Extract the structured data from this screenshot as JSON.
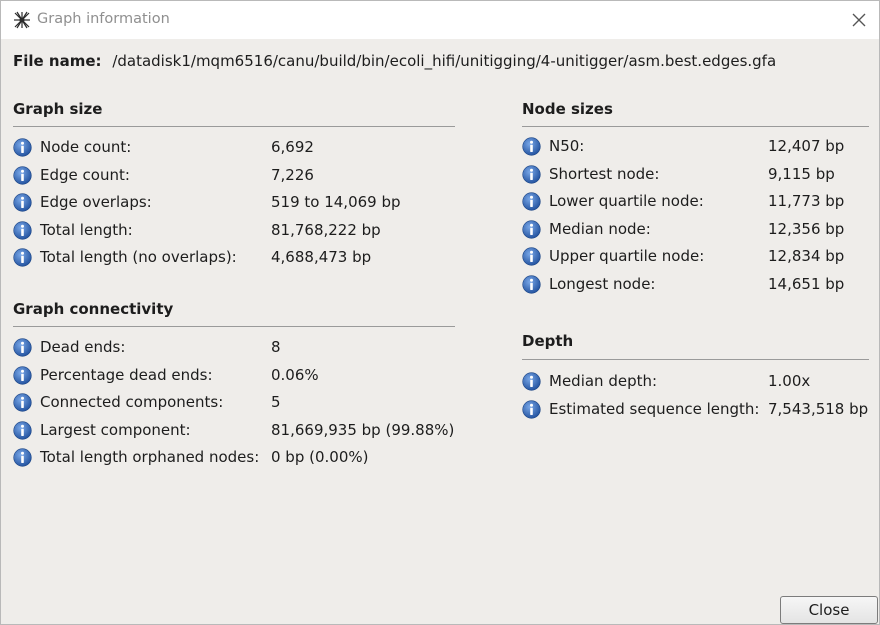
{
  "window": {
    "title": "Graph information",
    "close_glyph": "✕"
  },
  "file": {
    "label": "File name:",
    "path": "/datadisk1/mqm6516/canu/build/bin/ecoli_hifi/unitigging/4-unitigger/asm.best.edges.gfa"
  },
  "graph_size": {
    "title": "Graph size",
    "rows": [
      {
        "label": "Node count:",
        "value": "6,692"
      },
      {
        "label": "Edge count:",
        "value": "7,226"
      },
      {
        "label": "Edge overlaps:",
        "value": "519 to 14,069 bp"
      },
      {
        "label": "Total length:",
        "value": "81,768,222 bp"
      },
      {
        "label": "Total length (no overlaps):",
        "value": "4,688,473 bp"
      }
    ]
  },
  "graph_connectivity": {
    "title": "Graph connectivity",
    "rows": [
      {
        "label": "Dead ends:",
        "value": "8"
      },
      {
        "label": "Percentage dead ends:",
        "value": "0.06%"
      },
      {
        "label": "Connected components:",
        "value": "5"
      },
      {
        "label": "Largest component:",
        "value": "81,669,935 bp (99.88%)"
      },
      {
        "label": "Total length orphaned nodes:",
        "value": "0 bp (0.00%)"
      }
    ]
  },
  "node_sizes": {
    "title": "Node sizes",
    "rows": [
      {
        "label": "N50:",
        "value": "12,407 bp"
      },
      {
        "label": "Shortest node:",
        "value": "9,115 bp"
      },
      {
        "label": "Lower quartile node:",
        "value": "11,773 bp"
      },
      {
        "label": "Median node:",
        "value": "12,356 bp"
      },
      {
        "label": "Upper quartile node:",
        "value": "12,834 bp"
      },
      {
        "label": "Longest node:",
        "value": "14,651 bp"
      }
    ]
  },
  "depth": {
    "title": "Depth",
    "rows": [
      {
        "label": "Median depth:",
        "value": "1.00x"
      },
      {
        "label": "Estimated sequence length:",
        "value": "7,543,518 bp"
      }
    ]
  },
  "buttons": {
    "close": "Close"
  },
  "icons": {
    "info": "info-icon",
    "app": "app-icon"
  },
  "colors": {
    "info_blue": "#2f64b5",
    "rule": "#9a9a9a",
    "background": "#efedea"
  }
}
